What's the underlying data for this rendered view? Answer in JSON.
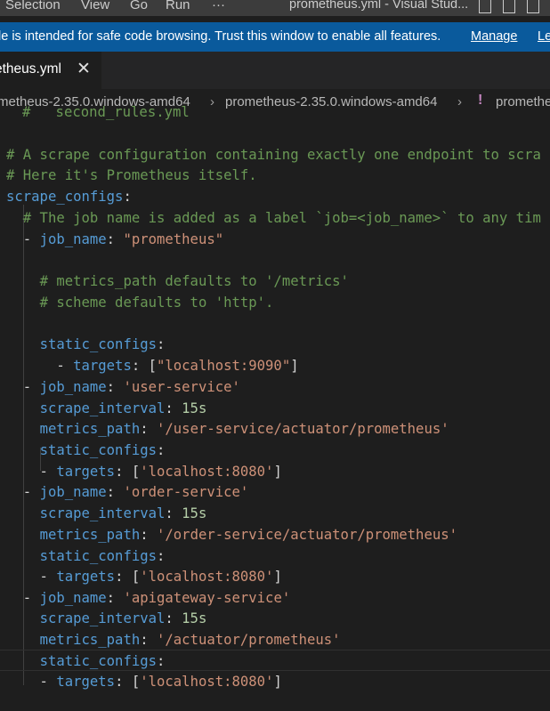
{
  "titlebar": {
    "menu": [
      "Selection",
      "View",
      "Go",
      "Run",
      "···"
    ],
    "title": "prometheus.yml - Visual Stud..."
  },
  "banner": {
    "message": "le is intended for safe code browsing. Trust this window to enable all features.",
    "manage": "Manage",
    "learn": "Le"
  },
  "tab": {
    "label": "etheus.yml",
    "close": "✕"
  },
  "breadcrumb": {
    "items": [
      "metheus-2.35.0.windows-amd64",
      "prometheus-2.35.0.windows-amd64",
      "prometheu"
    ],
    "file_icon": "!"
  },
  "code": {
    "l0": "#   second_rules.yml",
    "l1": "# A scrape configuration containing exactly one endpoint to scra",
    "l2": "# Here it's Prometheus itself.",
    "l3k": "scrape_configs",
    "l4": "# The job name is added as a label `job=<job_name>` to any tim",
    "job": "job_name",
    "v_prom": "\"prometheus\"",
    "c_metrics": "# metrics_path defaults to '/metrics'",
    "c_scheme": "# scheme defaults to 'http'.",
    "static": "static_configs",
    "targets": "targets",
    "v_9090": "\"localhost:9090\"",
    "v_user": "'user-service'",
    "interval": "scrape_interval",
    "v_15s": "15s",
    "mpath": "metrics_path",
    "v_user_path": "'/user-service/actuator/prometheus'",
    "v_8080": "'localhost:8080'",
    "v_order": "'order-service'",
    "v_order_path": "'/order-service/actuator/prometheus'",
    "v_api": "'apigateway-service'",
    "v_api_path": "'/actuator/prometheus'"
  }
}
